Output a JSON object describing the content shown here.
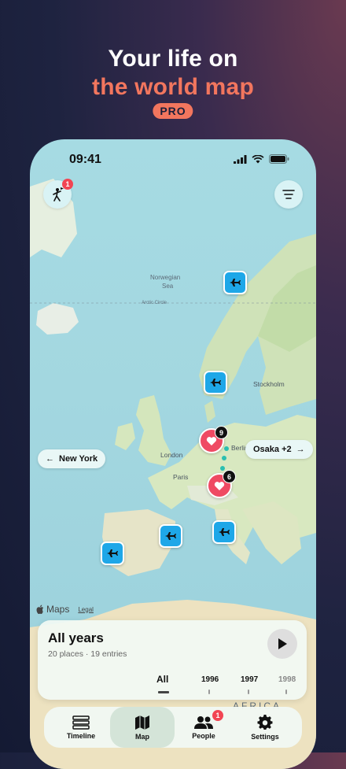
{
  "promo": {
    "headline_line1": "Your life on",
    "headline_line2": "the world map",
    "badge": "PRO"
  },
  "status_bar": {
    "time": "09:41"
  },
  "map": {
    "sea_labels": [
      "Norwegian",
      "Sea",
      "Arctic Circle"
    ],
    "cities": [
      "Berlin",
      "Stockholm",
      "London",
      "Paris"
    ],
    "region_label": "AFRICA",
    "credit": "Maps",
    "legal": "Legal",
    "notification_count": "1",
    "heart_markers": [
      {
        "count": "9"
      },
      {
        "count": "6"
      }
    ],
    "offscreen_left": "New York",
    "offscreen_right": "Osaka +2"
  },
  "panel": {
    "title": "All years",
    "subtitle": "20 places · 19 entries",
    "years": [
      "All",
      "1996",
      "1997",
      "1998"
    ]
  },
  "tabs": [
    {
      "label": "Timeline",
      "icon": "timeline-icon"
    },
    {
      "label": "Map",
      "icon": "map-icon"
    },
    {
      "label": "People",
      "icon": "people-icon",
      "badge": "1"
    },
    {
      "label": "Settings",
      "icon": "gear-icon"
    }
  ],
  "colors": {
    "accent": "#f2765e",
    "plane_marker": "#1ea7e8",
    "heart_marker": "#ef4a63",
    "badge": "#f24553"
  }
}
